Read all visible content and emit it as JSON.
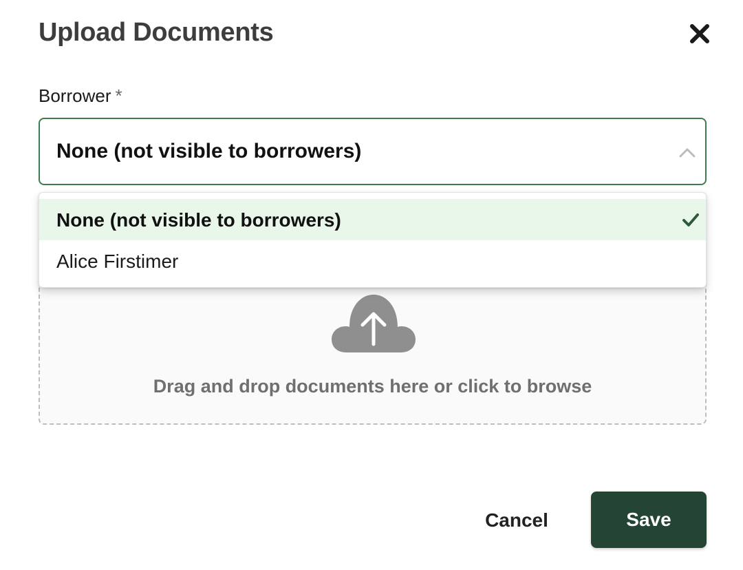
{
  "dialog": {
    "title": "Upload Documents",
    "close_icon": "close-icon"
  },
  "borrower_field": {
    "label": "Borrower",
    "required_marker": "*",
    "selected_value": "None (not visible to borrowers)",
    "state": "open",
    "chevron_icon": "chevron-up-icon"
  },
  "borrower_options": [
    {
      "label": "None (not visible to borrowers)",
      "selected": true,
      "check_icon": "check-icon"
    },
    {
      "label": "Alice Firstimer",
      "selected": false
    }
  ],
  "upload_zone": {
    "icon": "cloud-upload-icon",
    "hint": "Drag and drop documents here or click to browse"
  },
  "footer": {
    "cancel_label": "Cancel",
    "save_label": "Save"
  },
  "colors": {
    "accent_border": "#3f7a4c",
    "selected_option_bg": "#e9f7ea",
    "check": "#2f5a3a",
    "save_button_bg": "#244534"
  }
}
